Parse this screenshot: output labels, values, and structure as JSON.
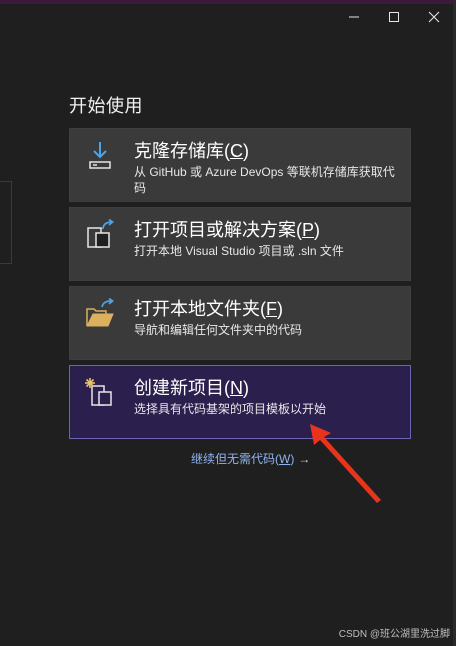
{
  "window": {
    "minimize_label": "",
    "maximize_label": "",
    "close_label": ""
  },
  "section_title": "开始使用",
  "cards": [
    {
      "title": "克隆存储库(",
      "key": "C",
      "title_end": ")",
      "desc": "从 GitHub 或 Azure DevOps 等联机存储库获取代码",
      "icon": "clone-download-icon"
    },
    {
      "title": "打开项目或解决方案(",
      "key": "P",
      "title_end": ")",
      "desc": "打开本地 Visual Studio 项目或 .sln 文件",
      "icon": "open-project-icon"
    },
    {
      "title": "打开本地文件夹(",
      "key": "F",
      "title_end": ")",
      "desc": "导航和编辑任何文件夹中的代码",
      "icon": "open-folder-icon"
    },
    {
      "title": "创建新项目(",
      "key": "N",
      "title_end": ")",
      "desc": "选择具有代码基架的项目模板以开始",
      "icon": "new-project-icon",
      "selected": true
    }
  ],
  "continue": {
    "text": "继续但无需代码(",
    "key": "W",
    "text_end": ")",
    "arrow": "→"
  },
  "watermark": "CSDN @班公湖里洗过脚",
  "colors": {
    "background": "#1f1f1f",
    "card": "#3a3a3a",
    "selected_card": "#2b1f4d",
    "selected_border": "#6f62b3",
    "link": "#8fb4f0",
    "icon_blue": "#4ea3e6",
    "folder_yellow": "#dcb05c",
    "annotation_red": "#e8341c"
  }
}
